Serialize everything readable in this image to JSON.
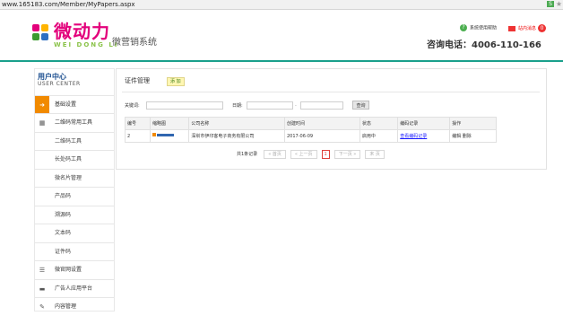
{
  "browser": {
    "url": "www.165183.com/Member/MyPapers.aspx",
    "ext_icon": "S"
  },
  "header": {
    "logo_title": "微动力",
    "logo_sub": "WEI DONG LI",
    "logo_tagline": "微营销系统",
    "help_label": "系统使用帮助",
    "messages_label": "站内消息",
    "messages_count": "0",
    "hotline": "咨询电话：4006-110-166",
    "accent_color": "#1aa08c"
  },
  "sidebar": {
    "title": "用户中心",
    "title_en": "USER CENTER",
    "items": [
      {
        "label": "基础设置",
        "icon": "arrow-right-icon",
        "active": true
      },
      {
        "label": "二维码常用工具",
        "icon": "qrcode-icon",
        "active": false
      },
      {
        "label": "二维码工具",
        "icon": "",
        "active": false
      },
      {
        "label": "长处码工具",
        "icon": "",
        "active": false
      },
      {
        "label": "微名片管理",
        "icon": "",
        "active": false
      },
      {
        "label": "产品码",
        "icon": "",
        "active": false
      },
      {
        "label": "溯源码",
        "icon": "",
        "active": false
      },
      {
        "label": "文本码",
        "icon": "",
        "active": false
      },
      {
        "label": "证件码",
        "icon": "",
        "active": false
      },
      {
        "label": "微官网设置",
        "icon": "list-icon",
        "active": false
      },
      {
        "label": "广告人应用平台",
        "icon": "ad-icon",
        "active": false
      },
      {
        "label": "内容管理",
        "icon": "edit-icon",
        "active": false
      }
    ]
  },
  "main": {
    "title": "证件管理",
    "add_label": "添 加",
    "search": {
      "keyword_label": "关键词:",
      "keyword_value": "",
      "date_label": "日期:",
      "date_from": "",
      "date_sep": "-",
      "date_to": "",
      "query_label": "查询"
    },
    "table": {
      "headers": [
        "编号",
        "缩略图",
        "公司名称",
        "创建时间",
        "状态",
        "编码记录",
        "操作"
      ],
      "rows": [
        {
          "id": "2",
          "company": "深圳市伊印客电子商务有限公司",
          "created": "2017-06-09",
          "status": "启用中",
          "record": "查看编码记录",
          "actions": "编辑 删除"
        }
      ]
    },
    "pager": {
      "total": "共1条记录",
      "first": "« 首页",
      "prev": "« 上一页",
      "current": "1",
      "next": "下一页 »",
      "last": "末 页"
    }
  }
}
